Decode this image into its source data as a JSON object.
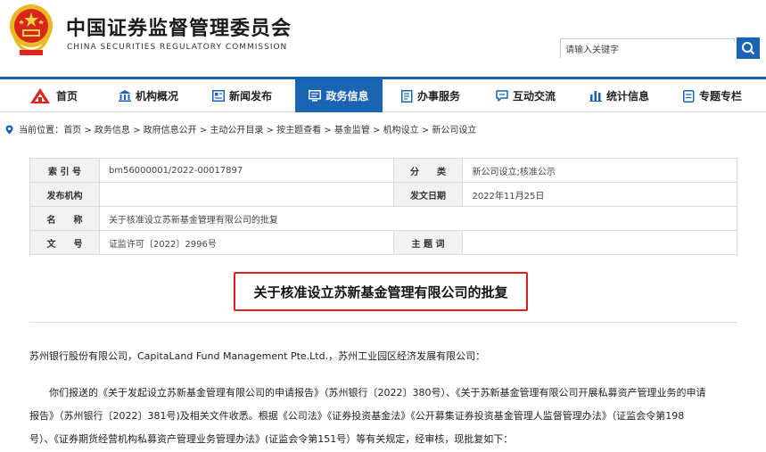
{
  "header": {
    "title_cn": "中国证券监督管理委员会",
    "title_en": "CHINA SECURITIES REGULATORY COMMISSION",
    "search_placeholder": "请输入关键字"
  },
  "nav": {
    "items": [
      {
        "label": "首页",
        "icon": "home-logo-icon"
      },
      {
        "label": "机构概况",
        "icon": "building-icon"
      },
      {
        "label": "新闻发布",
        "icon": "newspaper-icon"
      },
      {
        "label": "政务信息",
        "icon": "government-info-icon",
        "active": true
      },
      {
        "label": "办事服务",
        "icon": "service-document-icon"
      },
      {
        "label": "互动交流",
        "icon": "chat-icon"
      },
      {
        "label": "统计信息",
        "icon": "bar-chart-icon"
      },
      {
        "label": "专题专栏",
        "icon": "topic-icon"
      }
    ],
    "accent_color": "#1a64b4"
  },
  "breadcrumb": {
    "prefix": "当前位置：",
    "path": "首页 > 政务信息 > 政府信息公开 > 主动公开目录 > 按主题查看 > 基金监管 > 机构设立 > 新公司设立"
  },
  "meta": {
    "index_label": "索 引 号",
    "index_value": "bm56000001/2022-00017897",
    "category_label": "分　　类",
    "category_value": "新公司设立;核准公示",
    "publisher_label": "发布机构",
    "publisher_value": "",
    "date_label": "发文日期",
    "date_value": "2022年11月25日",
    "name_label": "名　　称",
    "name_value": "关于核准设立苏新基金管理有限公司的批复",
    "docno_label": "文　　号",
    "docno_value": "证监许可〔2022〕2996号",
    "subject_label": "主 题 词",
    "subject_value": ""
  },
  "document": {
    "title": "关于核准设立苏新基金管理有限公司的批复",
    "highlight_color": "#e02020",
    "addressee": "苏州银行股份有限公司，CapitaLand Fund Management Pte.Ltd.，苏州工业园区经济发展有限公司：",
    "body_line1": "你们报送的《关于发起设立苏新基金管理有限公司的申请报告》（苏州银行〔2022〕380号）、《关于苏新基金管理有限公司开展私募资产管理业务的申请",
    "body_line2": "报告》（苏州银行〔2022〕381号)及相关文件收悉。根据《公司法》《证券投资基金法》《公开募集证券投资基金管理人监督管理办法》（证监会令第198",
    "body_line3": "号）、《证券期货经营机构私募资产管理业务管理办法》(证监会令第151号）等有关规定，经审核，现批复如下："
  }
}
